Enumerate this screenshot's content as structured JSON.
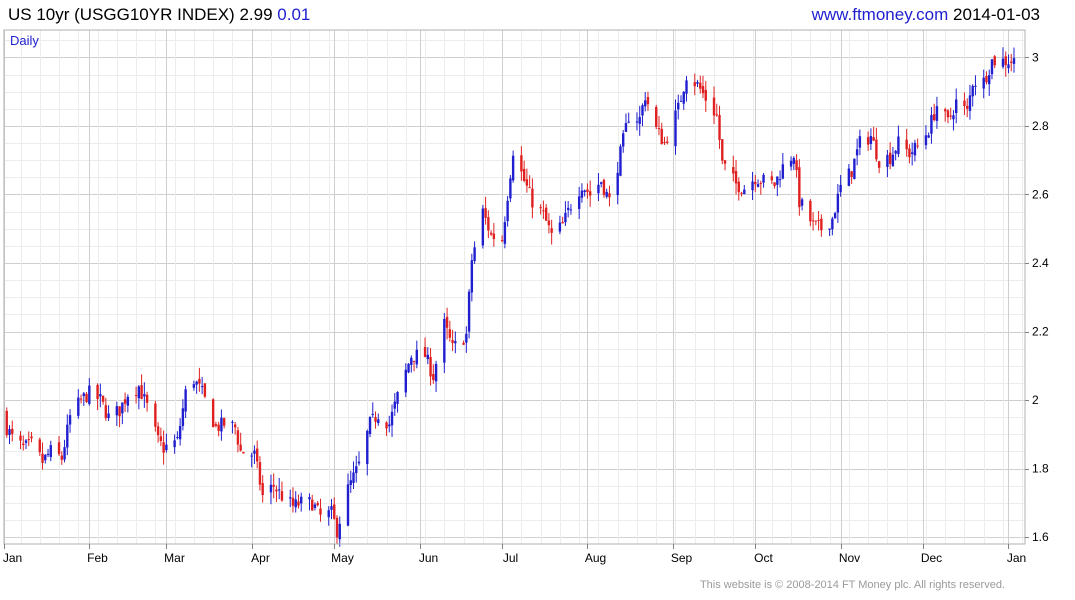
{
  "header": {
    "symbol": "US 10yr (USGG10YR INDEX)",
    "last": "2.99",
    "change": "0.01",
    "site": "www.ftmoney.com",
    "date": "2014-01-03"
  },
  "footer": {
    "copyright": "This website is © 2008-2014 FT Money plc. All rights reserved."
  },
  "colors": {
    "up": "#1f1fd0",
    "down": "#e02020",
    "grid": "#d9d9d9",
    "frame": "#b0b0b0",
    "label": "#1f1fd0"
  },
  "chart_data": {
    "type": "candlestick",
    "period_label": "Daily",
    "ylim": [
      1.58,
      3.08
    ],
    "yticks": [
      1.6,
      1.8,
      2.0,
      2.2,
      2.4,
      2.6,
      2.8,
      3.0
    ],
    "ytick_labels": [
      "1.6",
      "1.8",
      "2",
      "2.2",
      "2.4",
      "2.6",
      "2.8",
      "3"
    ],
    "y_axis_side": "right",
    "grid": true,
    "x_domain": [
      "2013-01-01",
      "2014-01-07"
    ],
    "xticks": [
      {
        "date": "2013-01-01",
        "label": "Jan"
      },
      {
        "date": "2013-02-01",
        "label": "Feb"
      },
      {
        "date": "2013-03-01",
        "label": "Mar"
      },
      {
        "date": "2013-04-01",
        "label": "Apr"
      },
      {
        "date": "2013-05-01",
        "label": "May"
      },
      {
        "date": "2013-06-01",
        "label": "Jun"
      },
      {
        "date": "2013-07-01",
        "label": "Jul"
      },
      {
        "date": "2013-08-01",
        "label": "Aug"
      },
      {
        "date": "2013-09-01",
        "label": "Sep"
      },
      {
        "date": "2013-10-01",
        "label": "Oct"
      },
      {
        "date": "2013-11-01",
        "label": "Nov"
      },
      {
        "date": "2013-12-01",
        "label": "Dec"
      },
      {
        "date": "2014-01-01",
        "label": "Jan"
      }
    ],
    "close_anchors": [
      [
        "2013-01-02",
        1.92
      ],
      [
        "2013-01-04",
        1.89
      ],
      [
        "2013-01-08",
        1.86
      ],
      [
        "2013-01-11",
        1.87
      ],
      [
        "2013-01-15",
        1.82
      ],
      [
        "2013-01-18",
        1.85
      ],
      [
        "2013-01-22",
        1.83
      ],
      [
        "2013-01-25",
        1.95
      ],
      [
        "2013-01-29",
        2.0
      ],
      [
        "2013-02-01",
        2.02
      ],
      [
        "2013-02-05",
        2.0
      ],
      [
        "2013-02-08",
        1.95
      ],
      [
        "2013-02-12",
        1.97
      ],
      [
        "2013-02-15",
        2.02
      ],
      [
        "2013-02-19",
        2.04
      ],
      [
        "2013-02-22",
        1.98
      ],
      [
        "2013-02-26",
        1.88
      ],
      [
        "2013-02-28",
        1.86
      ],
      [
        "2013-03-05",
        1.88
      ],
      [
        "2013-03-08",
        2.02
      ],
      [
        "2013-03-11",
        2.06
      ],
      [
        "2013-03-14",
        2.02
      ],
      [
        "2013-03-19",
        1.92
      ],
      [
        "2013-03-22",
        1.93
      ],
      [
        "2013-03-26",
        1.92
      ],
      [
        "2013-03-28",
        1.85
      ],
      [
        "2013-04-02",
        1.84
      ],
      [
        "2013-04-05",
        1.72
      ],
      [
        "2013-04-09",
        1.75
      ],
      [
        "2013-04-12",
        1.72
      ],
      [
        "2013-04-16",
        1.69
      ],
      [
        "2013-04-19",
        1.7
      ],
      [
        "2013-04-23",
        1.7
      ],
      [
        "2013-04-26",
        1.66
      ],
      [
        "2013-04-30",
        1.67
      ],
      [
        "2013-05-02",
        1.62
      ],
      [
        "2013-05-06",
        1.74
      ],
      [
        "2013-05-10",
        1.81
      ],
      [
        "2013-05-14",
        1.93
      ],
      [
        "2013-05-17",
        1.96
      ],
      [
        "2013-05-21",
        1.93
      ],
      [
        "2013-05-24",
        2.01
      ],
      [
        "2013-05-29",
        2.13
      ],
      [
        "2013-06-03",
        2.13
      ],
      [
        "2013-06-06",
        2.07
      ],
      [
        "2013-06-10",
        2.22
      ],
      [
        "2013-06-13",
        2.15
      ],
      [
        "2013-06-18",
        2.19
      ],
      [
        "2013-06-20",
        2.41
      ],
      [
        "2013-06-24",
        2.55
      ],
      [
        "2013-06-27",
        2.48
      ],
      [
        "2013-07-01",
        2.47
      ],
      [
        "2013-07-05",
        2.73
      ],
      [
        "2013-07-09",
        2.64
      ],
      [
        "2013-07-12",
        2.58
      ],
      [
        "2013-07-16",
        2.54
      ],
      [
        "2013-07-19",
        2.48
      ],
      [
        "2013-07-23",
        2.51
      ],
      [
        "2013-07-26",
        2.57
      ],
      [
        "2013-07-30",
        2.63
      ],
      [
        "2013-08-02",
        2.6
      ],
      [
        "2013-08-06",
        2.64
      ],
      [
        "2013-08-09",
        2.58
      ],
      [
        "2013-08-13",
        2.72
      ],
      [
        "2013-08-16",
        2.83
      ],
      [
        "2013-08-20",
        2.82
      ],
      [
        "2013-08-22",
        2.89
      ],
      [
        "2013-08-26",
        2.79
      ],
      [
        "2013-08-29",
        2.75
      ],
      [
        "2013-09-03",
        2.85
      ],
      [
        "2013-09-06",
        2.95
      ],
      [
        "2013-09-10",
        2.92
      ],
      [
        "2013-09-13",
        2.88
      ],
      [
        "2013-09-17",
        2.83
      ],
      [
        "2013-09-19",
        2.69
      ],
      [
        "2013-09-24",
        2.63
      ],
      [
        "2013-09-27",
        2.62
      ],
      [
        "2013-10-01",
        2.65
      ],
      [
        "2013-10-04",
        2.64
      ],
      [
        "2013-10-08",
        2.63
      ],
      [
        "2013-10-11",
        2.68
      ],
      [
        "2013-10-15",
        2.72
      ],
      [
        "2013-10-17",
        2.58
      ],
      [
        "2013-10-22",
        2.51
      ],
      [
        "2013-10-25",
        2.5
      ],
      [
        "2013-10-29",
        2.53
      ],
      [
        "2013-11-01",
        2.62
      ],
      [
        "2013-11-05",
        2.67
      ],
      [
        "2013-11-08",
        2.75
      ],
      [
        "2013-11-12",
        2.77
      ],
      [
        "2013-11-15",
        2.7
      ],
      [
        "2013-11-19",
        2.71
      ],
      [
        "2013-11-22",
        2.75
      ],
      [
        "2013-11-26",
        2.72
      ],
      [
        "2013-11-29",
        2.74
      ],
      [
        "2013-12-03",
        2.79
      ],
      [
        "2013-12-06",
        2.86
      ],
      [
        "2013-12-10",
        2.81
      ],
      [
        "2013-12-13",
        2.87
      ],
      [
        "2013-12-17",
        2.84
      ],
      [
        "2013-12-19",
        2.93
      ],
      [
        "2013-12-23",
        2.93
      ],
      [
        "2013-12-26",
        2.99
      ],
      [
        "2013-12-30",
        2.99
      ],
      [
        "2014-01-02",
        2.99
      ],
      [
        "2014-01-03",
        2.99
      ]
    ]
  }
}
